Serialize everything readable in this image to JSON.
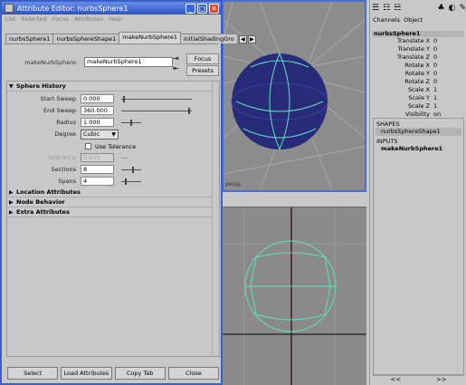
{
  "window": {
    "title": "Attribute Editor: nurbsSphere1",
    "menu": [
      "List",
      "Selected",
      "Focus",
      "Attributes",
      "Help"
    ]
  },
  "tabs": [
    "nurbsSphere1",
    "nurbsSphereShape1",
    "makeNurbSphere1",
    "initialShadingGro"
  ],
  "node": {
    "label": "makeNurbSphere:",
    "value": "makeNurbSphere1",
    "focus_label": "Focus",
    "presets_label": "Presets"
  },
  "sphere_history": {
    "title": "Sphere History",
    "start_sweep": {
      "label": "Start Sweep",
      "value": "0.000"
    },
    "end_sweep": {
      "label": "End Sweep",
      "value": "360.000"
    },
    "radius": {
      "label": "Radius",
      "value": "1.000"
    },
    "degree": {
      "label": "Degree",
      "value": "Cubic"
    },
    "use_tolerance": {
      "label": "Use Tolerance"
    },
    "tolerance": {
      "label": "Tolerance",
      "value": "0.010"
    },
    "sections": {
      "label": "Sections",
      "value": "8"
    },
    "spans": {
      "label": "Spans",
      "value": "4"
    }
  },
  "collapsed_sections": [
    "Location Attributes",
    "Node Behavior",
    "Extra Attributes"
  ],
  "bottom_buttons": [
    "Select",
    "Load Attributes",
    "Copy Tab",
    "Close"
  ],
  "viewport": {
    "persp_label": "persp",
    "sphere_color": "#272b7a",
    "wire_color": "#5fe0c0"
  },
  "channel_box": {
    "tabs": [
      "Channels",
      "Object"
    ],
    "object": "nurbsSphere1",
    "attributes": [
      {
        "name": "Translate X",
        "value": "0"
      },
      {
        "name": "Translate Y",
        "value": "0"
      },
      {
        "name": "Translate Z",
        "value": "0"
      },
      {
        "name": "Rotate X",
        "value": "0"
      },
      {
        "name": "Rotate Y",
        "value": "0"
      },
      {
        "name": "Rotate Z",
        "value": "0"
      },
      {
        "name": "Scale X",
        "value": "1"
      },
      {
        "name": "Scale Y",
        "value": "1"
      },
      {
        "name": "Scale Z",
        "value": "1"
      },
      {
        "name": "Visibility",
        "value": "on"
      }
    ],
    "shapes_header": "SHAPES",
    "shape": "nurbsSphereShape1",
    "inputs_header": "INPUTS",
    "input": "makeNurbSphere1",
    "scroll_left": "<<",
    "scroll_right": ">>"
  }
}
